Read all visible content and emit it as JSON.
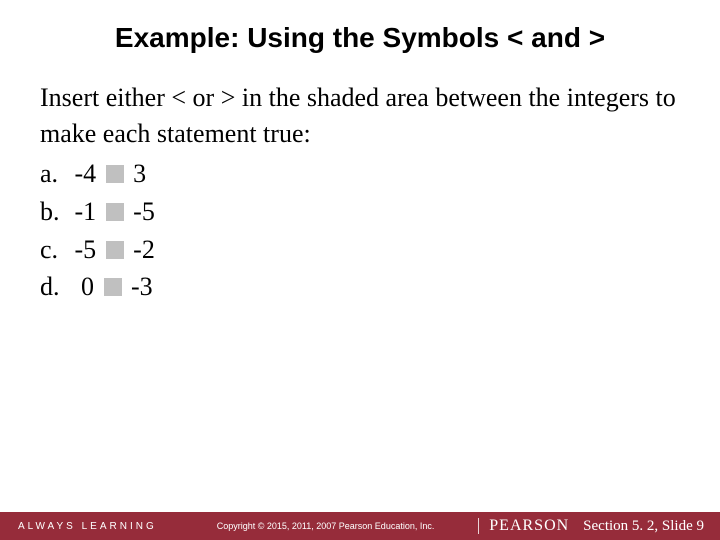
{
  "title": "Example:  Using the Symbols < and >",
  "intro": "Insert either < or > in the shaded area between the integers to make each statement true:",
  "items": {
    "a": {
      "label": "a.",
      "left_neg": true,
      "left": "4",
      "right_neg": false,
      "right": "3"
    },
    "b": {
      "label": "b.",
      "left_neg": true,
      "left": "1",
      "right_neg": true,
      "right": "5"
    },
    "c": {
      "label": "c.",
      "left_neg": true,
      "left": "5",
      "right_neg": true,
      "right": "2"
    },
    "d": {
      "label": "d.",
      "left_neg": false,
      "left": "0",
      "right_neg": true,
      "right": "3"
    }
  },
  "footer": {
    "always": "ALWAYS LEARNING",
    "copyright": "Copyright © 2015, 2011, 2007 Pearson Education, Inc.",
    "brand": "PEARSON",
    "section": "Section 5. 2,  Slide 9"
  },
  "glyphs": {
    "minus": "-"
  }
}
